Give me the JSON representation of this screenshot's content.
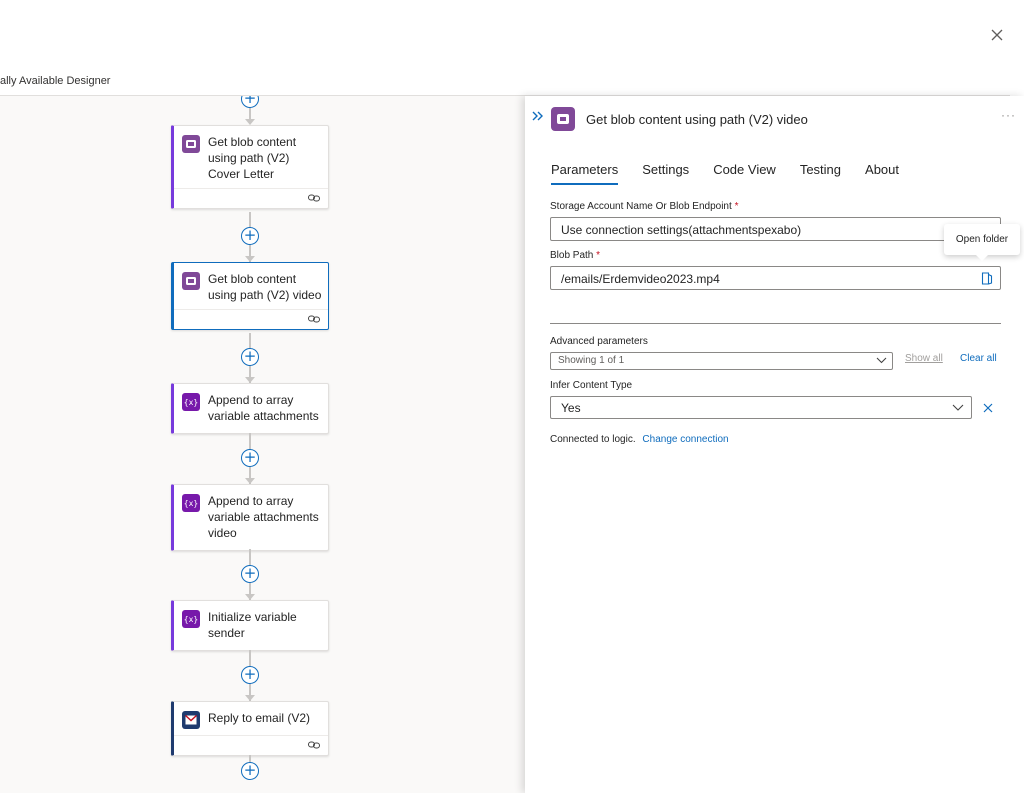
{
  "header": {
    "designer_label": "ally Available Designer"
  },
  "flow": {
    "cards": [
      {
        "title": "Get blob content using path (V2) Cover Letter"
      },
      {
        "title": "Get blob content using path (V2) video"
      },
      {
        "title": "Append to array variable attachments"
      },
      {
        "title": "Append to array variable attachments video"
      },
      {
        "title": "Initialize variable sender"
      },
      {
        "title": "Reply to email (V2)"
      }
    ],
    "add_symbol": "+"
  },
  "panel": {
    "title": "Get blob content using path (V2) video",
    "more_label": "···",
    "tabs": [
      {
        "label": "Parameters"
      },
      {
        "label": "Settings"
      },
      {
        "label": "Code View"
      },
      {
        "label": "Testing"
      },
      {
        "label": "About"
      }
    ],
    "storage": {
      "label": "Storage Account Name Or Blob Endpoint",
      "required": "*",
      "value": "Use connection settings(attachmentspexabo)"
    },
    "blob_path": {
      "label": "Blob Path",
      "required": "*",
      "value": "/emails/Erdemvideo2023.mp4",
      "tooltip": "Open folder"
    },
    "advanced": {
      "label": "Advanced parameters",
      "showing": "Showing 1 of 1",
      "show_all": "Show all",
      "clear_all": "Clear all"
    },
    "infer": {
      "label": "Infer Content Type",
      "value": "Yes"
    },
    "connection": {
      "text": "Connected to logic.",
      "change": "Change connection"
    }
  },
  "colors": {
    "accent": "#0f6cbd",
    "blob_icon": "#804998",
    "variable_icon": "#7719aa",
    "outlook_icon": "#1f3b6f",
    "required": "#c50f1f"
  }
}
